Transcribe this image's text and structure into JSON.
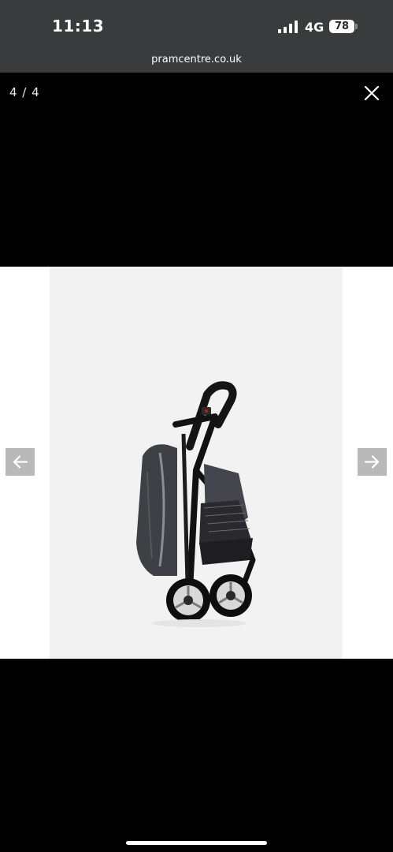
{
  "status_bar": {
    "time": "11:13",
    "network": "4G",
    "battery_level": "78",
    "icons": [
      "signal-bars-icon",
      "battery-icon"
    ]
  },
  "browser": {
    "url": "pramcentre.co.uk"
  },
  "gallery": {
    "counter": "4 / 4",
    "current_image": 4,
    "total_images": 4,
    "icons": [
      "close-icon",
      "arrow-left-icon",
      "arrow-right-icon"
    ],
    "photo_subject": "folded stroller"
  },
  "colors": {
    "status_bar_bg": "#3a3b3c",
    "viewer_bg": "#000000",
    "photo_bg": "#f2f2f2",
    "nav_button_bg": "#b9b9b9"
  }
}
